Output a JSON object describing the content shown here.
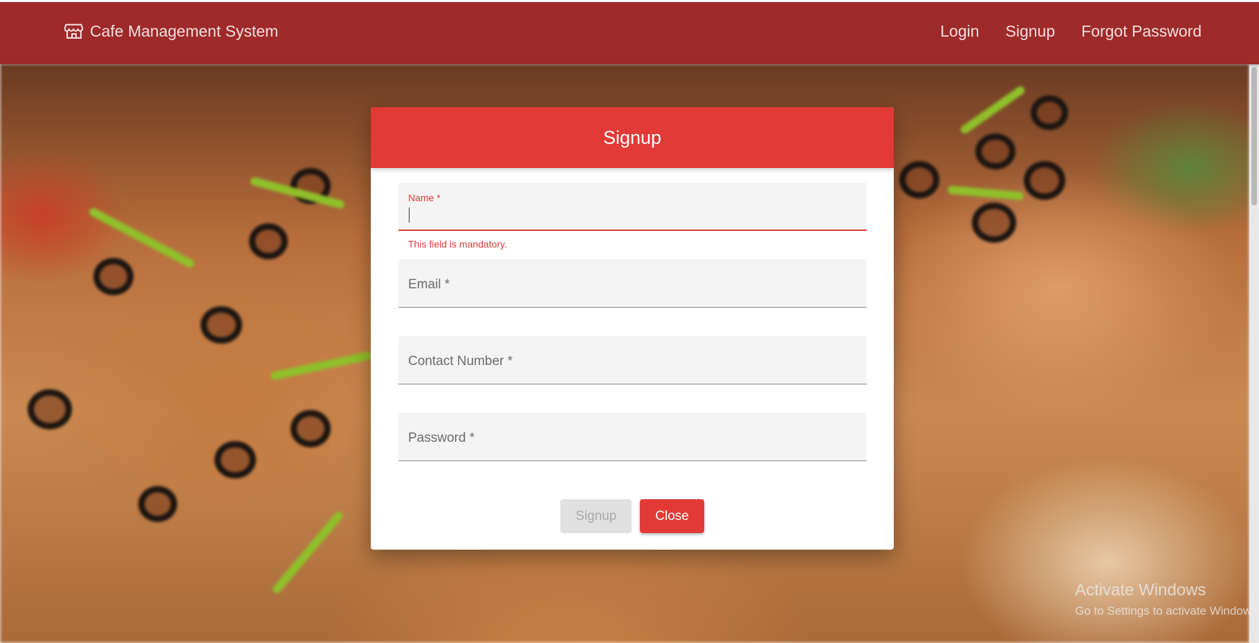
{
  "navbar": {
    "brand": "Cafe Management System",
    "brand_icon": "store-icon",
    "background_color": "#9e2a29",
    "links": [
      "Login",
      "Signup",
      "Forgot Password"
    ]
  },
  "dialog": {
    "title": "Signup",
    "header_color": "#e13a37",
    "fields": {
      "name": {
        "label": "Name *",
        "value": "",
        "error": "This field is mandatory."
      },
      "email": {
        "label": "Email *",
        "value": ""
      },
      "contact": {
        "label": "Contact Number *",
        "value": ""
      },
      "password": {
        "label": "Password *",
        "value": ""
      }
    },
    "buttons": {
      "signup": "Signup",
      "close": "Close"
    }
  },
  "watermark": {
    "title": "Activate Windows",
    "subtitle": "Go to Settings to activate Windows."
  }
}
